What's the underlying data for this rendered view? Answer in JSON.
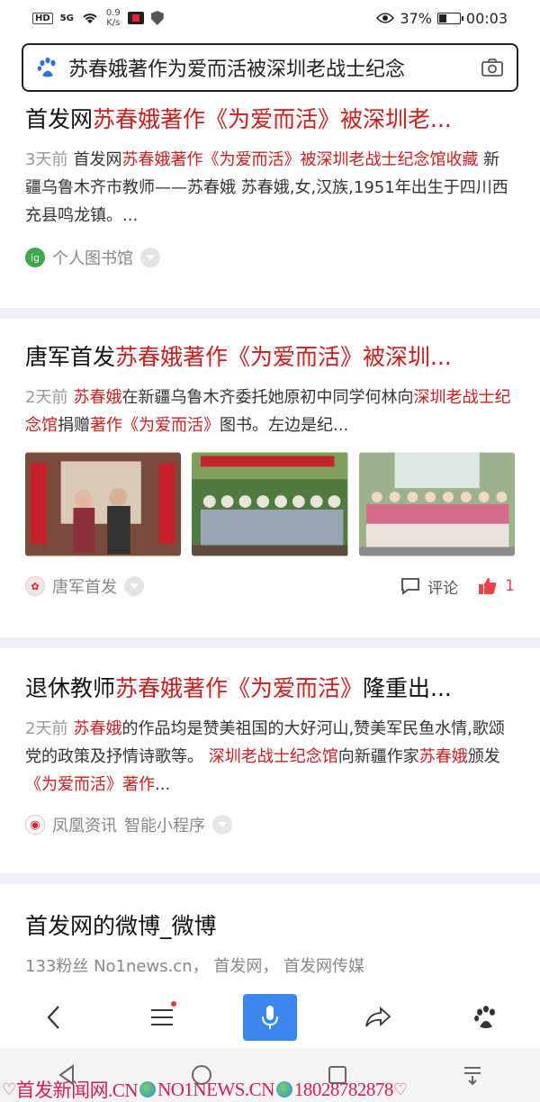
{
  "status_bar": {
    "hd": "HD",
    "signal": "5G",
    "speed_value": "0.9",
    "speed_unit": "K/s",
    "battery": "37%",
    "battery_level": 0.37,
    "time": "00:03"
  },
  "search": {
    "query": "苏春娥著作为爱而活被深圳老战士纪念"
  },
  "results": [
    {
      "title_prefix": "首发网",
      "title_hl": "苏春娥著作《为爱而活》被深圳老...",
      "ago": "3天前",
      "snippet_a": "首发网",
      "snippet_hl1": "苏春娥著作《为爱而活》被深圳老战士纪念馆收藏",
      "snippet_b": " 新疆乌鲁木齐市教师——苏春娥 苏春娥,女,汉族,1951年出生于四川西充县鸣龙镇。...",
      "source": "个人图书馆"
    },
    {
      "title_prefix": "唐军首发",
      "title_hl": "苏春娥著作《为爱而活》被深圳...",
      "ago": "2天前",
      "snippet_hl1": "苏春娥",
      "snippet_a": "在新疆乌鲁木齐委托她原初中同学何林向",
      "snippet_hl2": "深圳老战士纪念馆",
      "snippet_b": "捐赠",
      "snippet_hl3": "著作《为爱而活》",
      "snippet_c": "图书。左边是纪...",
      "source": "唐军首发",
      "comment_label": "评论",
      "like_count": "1"
    },
    {
      "title_prefix": "退休教师",
      "title_hl": "苏春娥著作《为爱而活》",
      "title_suffix": "隆重出...",
      "ago": "2天前",
      "snippet_hl1": "苏春娥",
      "snippet_a": "的作品均是赞美祖国的大好河山,赞美军民鱼水情,歌颂党的政策及抒情诗歌等。 ",
      "snippet_hl2": "深圳老战士纪念馆",
      "snippet_b": "向新疆作家",
      "snippet_hl3": "苏春娥",
      "snippet_c": "颁发",
      "snippet_hl4": "《为爱而活》著作",
      "snippet_d": "...",
      "source": "凤凰资讯",
      "source_extra": "智能小程序"
    },
    {
      "title": "首发网的微博_微博",
      "meta": "133粉丝   No1news.cn， 首发网， 首发网传媒"
    }
  ],
  "watermark": "首发新闻网.CN",
  "watermark2": "NO1NEWS.CN",
  "watermark3": "18028782878",
  "colors": {
    "highlight": "#c81f1f",
    "accent": "#3b87ee",
    "like": "#e8434a"
  }
}
